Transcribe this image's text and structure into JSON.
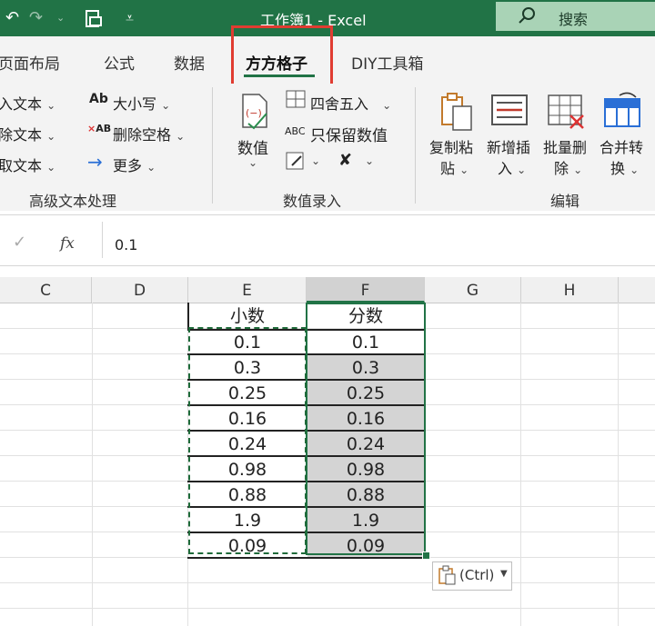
{
  "window": {
    "title": "工作簿1  -  Excel",
    "search_label": "搜索"
  },
  "tabs": [
    "页面布局",
    "公式",
    "数据",
    "方方格子",
    "DIY工具箱"
  ],
  "ribbon": {
    "text_group": {
      "items_left": [
        "入文本",
        "除文本",
        "取文本"
      ],
      "items_right": [
        "大小写",
        "删除空格",
        "更多"
      ],
      "label": "高级文本处理"
    },
    "value_group": {
      "big_button": "数值",
      "round_label": "四舍五入",
      "keep_label": "只保留数值",
      "label": "数值录入"
    },
    "edit_group": {
      "buttons": [
        {
          "line1": "复制粘",
          "line2": "贴"
        },
        {
          "line1": "新增插",
          "line2": "入"
        },
        {
          "line1": "批量删",
          "line2": "除"
        },
        {
          "line1": "合并转",
          "line2": "换"
        }
      ],
      "label": "编辑"
    }
  },
  "formula_bar": {
    "fx": "fx",
    "value": "0.1"
  },
  "columns": [
    "C",
    "D",
    "E",
    "F",
    "G",
    "H"
  ],
  "table": {
    "header_e": "小数",
    "header_f": "分数",
    "col_e": [
      "0.1",
      "0.3",
      "0.25",
      "0.16",
      "0.24",
      "0.98",
      "0.88",
      "1.9",
      "0.09"
    ],
    "col_f": [
      "0.1",
      "0.3",
      "0.25",
      "0.16",
      "0.24",
      "0.98",
      "0.88",
      "1.9",
      "0.09"
    ]
  },
  "paste_options": {
    "label": "(Ctrl)"
  },
  "colors": {
    "excel_green": "#217346",
    "highlight_red": "#e03c31",
    "selection_gray": "#d4d4d4"
  }
}
